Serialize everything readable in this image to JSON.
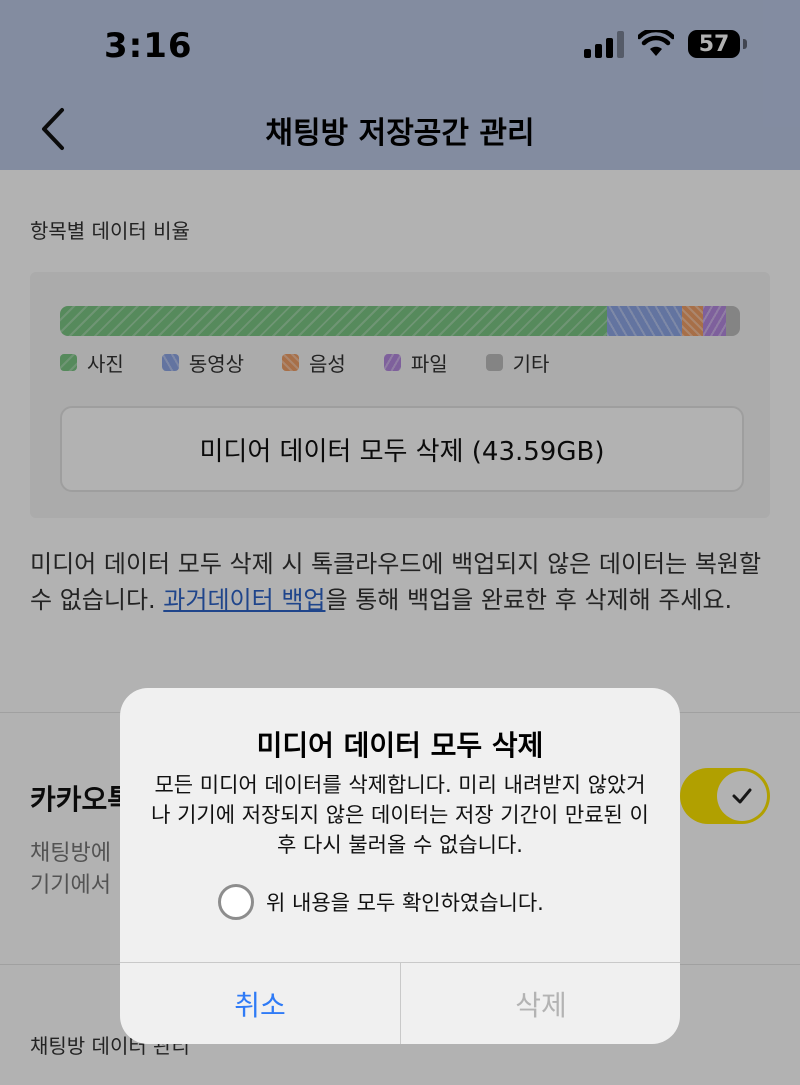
{
  "status_bar": {
    "time": "3:16",
    "battery": "57"
  },
  "nav": {
    "title": "채팅방 저장공간 관리"
  },
  "ratio": {
    "label": "항목별 데이터 비율",
    "segments": [
      {
        "name": "사진",
        "fraction": 0.805,
        "color": "#7cc685"
      },
      {
        "name": "동영상",
        "fraction": 0.11,
        "color": "#8ea6e6"
      },
      {
        "name": "음성",
        "fraction": 0.03,
        "color": "#f0a068"
      },
      {
        "name": "파일",
        "fraction": 0.035,
        "color": "#b58ae0"
      },
      {
        "name": "기타",
        "fraction": 0.02,
        "color": "#bdbdbd"
      }
    ],
    "legend": [
      "사진",
      "동영상",
      "음성",
      "파일",
      "기타"
    ],
    "delete_all_button": "미디어 데이터 모두 삭제 (43.59GB)"
  },
  "notice": {
    "before": "미디어 데이터 모두 삭제 시 톡클라우드에 백업되지 않은 데이터는 복원할 수 없습니다. ",
    "link": "과거데이터 백업",
    "after": "을 통해 백업을 완료한 후 삭제해 주세요."
  },
  "kakao": {
    "title": "카카오톡",
    "desc_line1": "채팅방에",
    "desc_line2": "기기에서"
  },
  "section2": {
    "label": "채팅방 데이터 관리"
  },
  "alert": {
    "title": "미디어 데이터 모두 삭제",
    "message": "모든 미디어 데이터를 삭제합니다. 미리 내려받지 않았거나 기기에 저장되지 않은 데이터는 저장 기간이 만료된 이후 다시 불러올 수 없습니다.",
    "confirm_label": "위 내용을 모두 확인하였습니다.",
    "cancel": "취소",
    "delete": "삭제"
  }
}
